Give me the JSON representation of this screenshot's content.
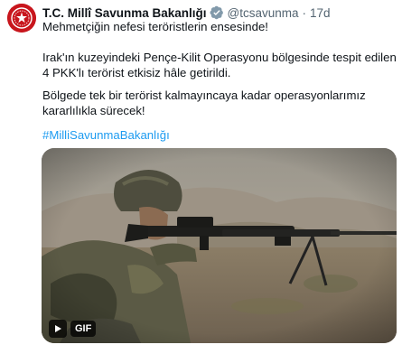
{
  "tweet": {
    "author_name": "T.C. Millî Savunma Bakanlığı",
    "author_handle": "@tcsavunma",
    "separator": "·",
    "timestamp": "17d",
    "paragraphs": [
      "Mehmetçiğin nefesi teröristlerin ensesinde!",
      "Irak'ın kuzeyindeki Pençe-Kilit Operasyonu bölgesinde tespit edilen 4 PKK'lı terörist etkisiz hâle getirildi.",
      "Bölgede tek bir terörist kalmayıncaya kadar operasyonlarımız kararlılıkla sürecek!"
    ],
    "hashtag": "#MilliSavunmaBakanlığı",
    "media": {
      "type": "gif",
      "badge_label": "GIF",
      "play_icon": "play-icon"
    }
  },
  "colors": {
    "link": "#1d9bf0",
    "verified_badge": "#829aab",
    "avatar_bg": "#c8161d",
    "text_primary": "#0f1419",
    "text_secondary": "#536471"
  }
}
